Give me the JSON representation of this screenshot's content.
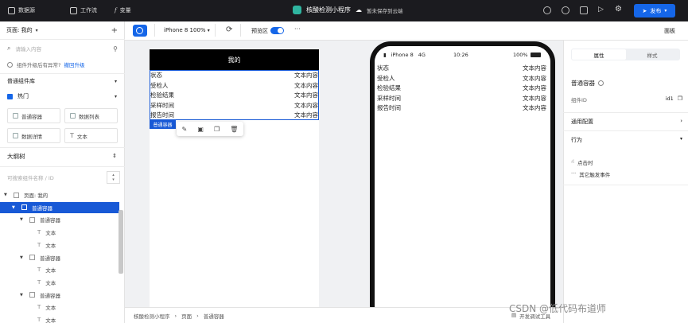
{
  "topbar": {
    "nav": [
      {
        "label": "数据源",
        "icon": "database-icon"
      },
      {
        "label": "工作流",
        "icon": "workflow-icon"
      },
      {
        "label": "变量",
        "icon": "fx-icon"
      }
    ],
    "app_title": "核酸检测小程序",
    "save_status": "暂未保存到云端",
    "publish_label": "发布"
  },
  "left": {
    "page_label": "页面: 我的",
    "search_placeholder": "请输入内容",
    "upgrade_notice": "组件升级后有异常?",
    "upgrade_link": "撤回升级",
    "common_lib": "普通组件库",
    "hot_label": "热门",
    "components": [
      "普通容器",
      "数据列表",
      "数据详情",
      "文本"
    ],
    "outline_title": "大纲树",
    "outline_search_placeholder": "可搜索组件名称 / ID",
    "tree": [
      {
        "label": "页面: 我的",
        "indent": 0,
        "icon": "page-icon",
        "selected": false,
        "arrow": true
      },
      {
        "label": "普通容器",
        "indent": 1,
        "icon": "container-icon",
        "selected": true,
        "arrow": true
      },
      {
        "label": "普通容器",
        "indent": 2,
        "icon": "container-icon",
        "selected": false,
        "arrow": true
      },
      {
        "label": "文本",
        "indent": 3,
        "icon": "text-icon",
        "selected": false,
        "arrow": false
      },
      {
        "label": "文本",
        "indent": 3,
        "icon": "text-icon",
        "selected": false,
        "arrow": false
      },
      {
        "label": "普通容器",
        "indent": 2,
        "icon": "container-icon",
        "selected": false,
        "arrow": true
      },
      {
        "label": "文本",
        "indent": 3,
        "icon": "text-icon",
        "selected": false,
        "arrow": false
      },
      {
        "label": "文本",
        "indent": 3,
        "icon": "text-icon",
        "selected": false,
        "arrow": false
      },
      {
        "label": "普通容器",
        "indent": 2,
        "icon": "container-icon",
        "selected": false,
        "arrow": true
      },
      {
        "label": "文本",
        "indent": 3,
        "icon": "text-icon",
        "selected": false,
        "arrow": false
      },
      {
        "label": "文本",
        "indent": 3,
        "icon": "text-icon",
        "selected": false,
        "arrow": false
      }
    ]
  },
  "toolbar": {
    "device": "iPhone 8 100%",
    "preview_label": "预览区",
    "more": "···",
    "panel_label": "面板"
  },
  "editor": {
    "page_title": "我的",
    "rows": [
      {
        "k": "状态",
        "v": "文本内容"
      },
      {
        "k": "受检人",
        "v": "文本内容"
      },
      {
        "k": "检验结果",
        "v": "文本内容"
      },
      {
        "k": "采样时间",
        "v": "文本内容"
      },
      {
        "k": "报告时间",
        "v": "文本内容"
      }
    ],
    "selected_tag": "普通容器"
  },
  "phone": {
    "carrier": "iPhone 8",
    "network": "4G",
    "time": "10:26",
    "battery": "100%"
  },
  "right": {
    "tab_properties": "属性",
    "tab_style": "样式",
    "component_name": "普通容器",
    "component_id_label": "组件ID",
    "component_id": "id1",
    "general_config": "通用配置",
    "behavior": "行为",
    "click_event": "点击时",
    "other_events": "其它触发事件"
  },
  "bottombar": {
    "crumbs": [
      "核酸检测小程序",
      "页面",
      "普通容器"
    ],
    "devtools": "开发调试工具"
  },
  "watermark": "CSDN @低代码布道师",
  "colors": {
    "accent": "#1566e8",
    "selection": "#1859d6",
    "topbar": "#1b1b1f"
  }
}
